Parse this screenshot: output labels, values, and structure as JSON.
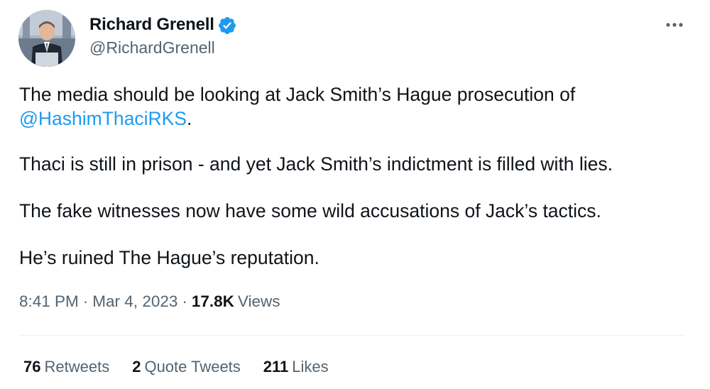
{
  "author": {
    "display_name": "Richard Grenell",
    "handle": "@RichardGrenell",
    "verified": true,
    "avatar_icon": "profile-photo"
  },
  "tweet": {
    "paragraphs": [
      {
        "text": "The media should be looking at Jack Smith’s Hague prosecution of ",
        "mention": "@HashimThaciRKS",
        "after": "."
      },
      {
        "text": "Thaci is still in prison - and yet Jack Smith’s indictment is filled with lies."
      },
      {
        "text": "The fake witnesses now have some wild accusations of Jack’s tactics."
      },
      {
        "text": "He’s ruined The Hague’s reputation."
      }
    ]
  },
  "meta": {
    "time": "8:41 PM",
    "separator": "·",
    "date": "Mar 4, 2023",
    "views_count": "17.8K",
    "views_label": "Views"
  },
  "stats": {
    "retweets_count": "76",
    "retweets_label": "Retweets",
    "quotes_count": "2",
    "quotes_label": "Quote Tweets",
    "likes_count": "211",
    "likes_label": "Likes"
  },
  "colors": {
    "link": "#1d9bf0",
    "secondary_text": "#536471",
    "primary_text": "#0f1419",
    "verified_badge": "#1d9bf0",
    "divider": "#eff3f4"
  },
  "icons": {
    "more": "more-horizontal-icon",
    "verified": "verified-badge-icon"
  }
}
